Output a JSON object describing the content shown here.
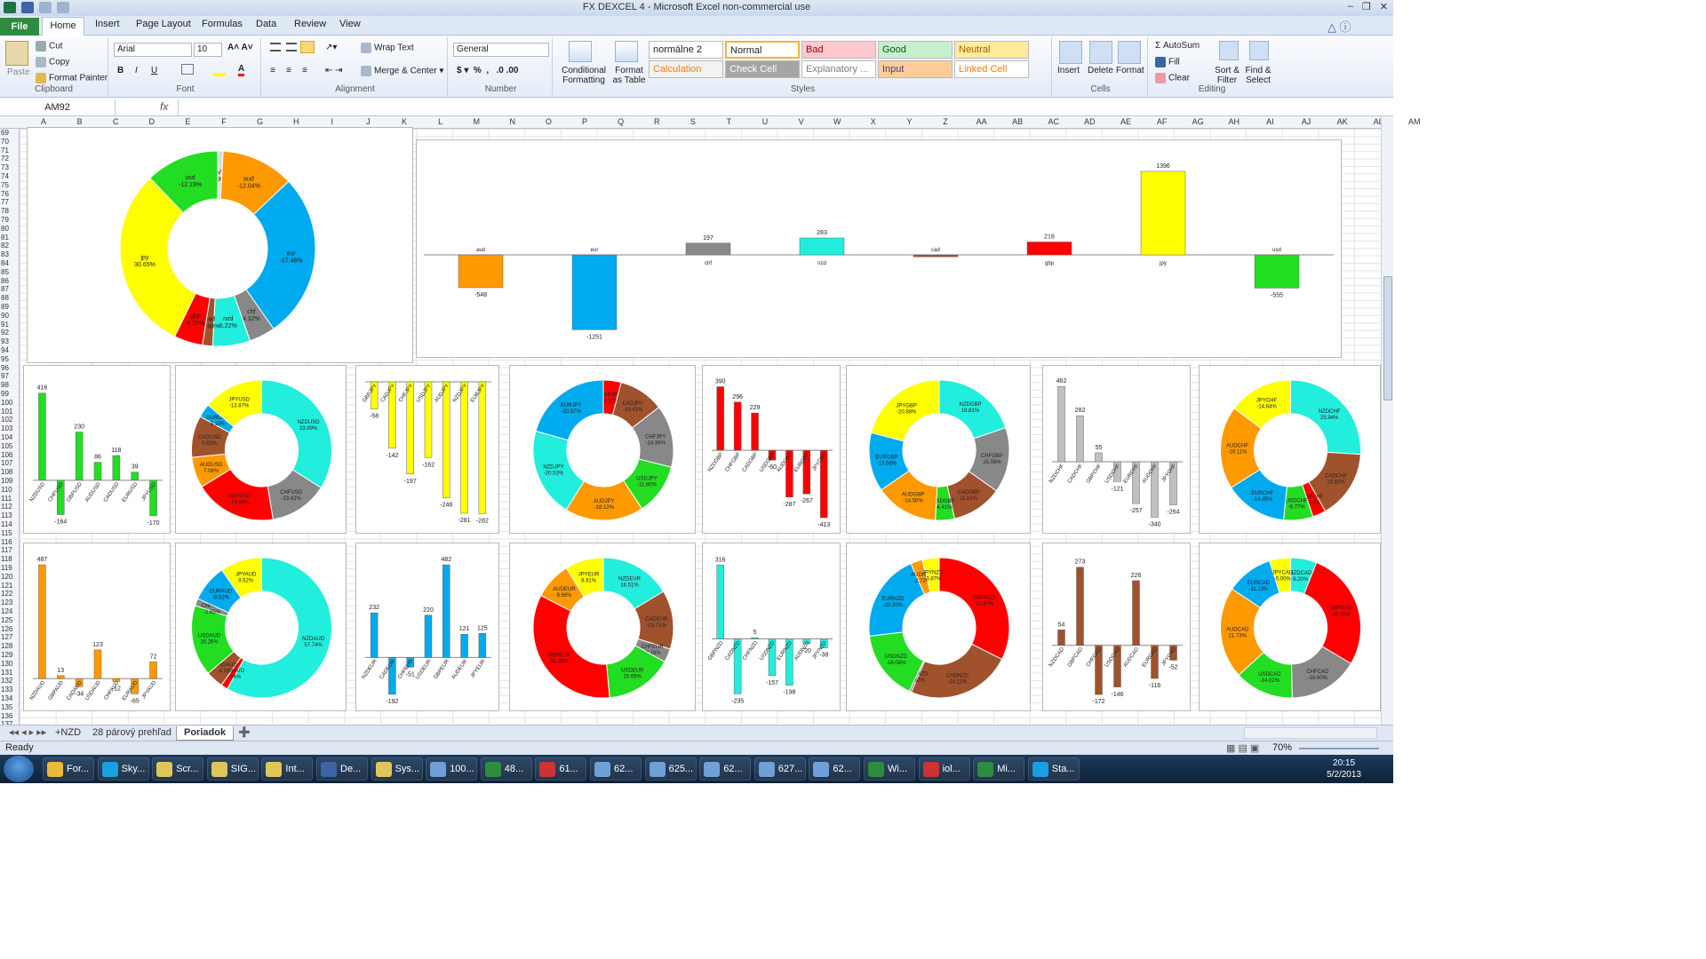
{
  "window": {
    "title": "FX DEXCEL 4  -  Microsoft Excel non-commercial use"
  },
  "tabs": [
    "File",
    "Home",
    "Insert",
    "Page Layout",
    "Formulas",
    "Data",
    "Review",
    "View"
  ],
  "ribbon": {
    "clipboard": {
      "paste": "Paste",
      "cut": "Cut",
      "copy": "Copy",
      "format_painter": "Format Painter",
      "label": "Clipboard"
    },
    "font": {
      "name": "Arial",
      "size": "10",
      "label": "Font"
    },
    "alignment": {
      "wrap": "Wrap Text",
      "merge": "Merge & Center",
      "label": "Alignment"
    },
    "number": {
      "format": "General",
      "label": "Number"
    },
    "styles": {
      "conditional": "Conditional Formatting",
      "format_table": "Format as Table",
      "label": "Styles",
      "cells": [
        {
          "text": "normálne 2",
          "bg": "#ffffff",
          "fg": "#222222"
        },
        {
          "text": "Normal",
          "bg": "#ffffff",
          "fg": "#222222"
        },
        {
          "text": "Bad",
          "bg": "#ffc7ce",
          "fg": "#9c0006"
        },
        {
          "text": "Good",
          "bg": "#c6efce",
          "fg": "#006100"
        },
        {
          "text": "Neutral",
          "bg": "#ffeb9c",
          "fg": "#9c6500"
        },
        {
          "text": "Calculation",
          "bg": "#f2f2f2",
          "fg": "#fa7d00"
        },
        {
          "text": "Check Cell",
          "bg": "#a5a5a5",
          "fg": "#ffffff"
        },
        {
          "text": "Explanatory ...",
          "bg": "#ffffff",
          "fg": "#7f7f7f"
        },
        {
          "text": "Input",
          "bg": "#ffcc99",
          "fg": "#3f3f76"
        },
        {
          "text": "Linked Cell",
          "bg": "#ffffff",
          "fg": "#fa7d00"
        }
      ]
    },
    "cells": {
      "insert": "Insert",
      "delete": "Delete",
      "format": "Format",
      "label": "Cells"
    },
    "editing": {
      "autosum": "AutoSum",
      "fill": "Fill",
      "clear": "Clear",
      "sort": "Sort & Filter",
      "find": "Find & Select",
      "label": "Editing"
    }
  },
  "formula_bar": {
    "name_box": "AM92",
    "fx": "fx",
    "value": ""
  },
  "columns": [
    "A",
    "B",
    "C",
    "D",
    "E",
    "F",
    "G",
    "H",
    "I",
    "J",
    "K",
    "L",
    "M",
    "N",
    "O",
    "P",
    "Q",
    "R",
    "S",
    "T",
    "U",
    "V",
    "W",
    "X",
    "Y",
    "Z",
    "AA",
    "AB",
    "AC",
    "AD",
    "AE",
    "AF",
    "AG",
    "AH",
    "AI",
    "AJ",
    "AK",
    "AL",
    "AM"
  ],
  "rows": [
    "69",
    "70",
    "71",
    "72",
    "73",
    "74",
    "75",
    "76",
    "77",
    "78",
    "79",
    "80",
    "81",
    "82",
    "83",
    "84",
    "85",
    "86",
    "87",
    "88",
    "89",
    "90",
    "91",
    "92",
    "93",
    "94",
    "95",
    "96",
    "97",
    "98",
    "99",
    "100",
    "101",
    "102",
    "103",
    "104",
    "105",
    "106",
    "107",
    "108",
    "109",
    "110",
    "111",
    "112",
    "113",
    "114",
    "115",
    "116",
    "117",
    "118",
    "119",
    "120",
    "121",
    "122",
    "123",
    "124",
    "125",
    "126",
    "127",
    "128",
    "129",
    "130",
    "131",
    "132",
    "133",
    "134",
    "135",
    "136",
    "137"
  ],
  "colors": {
    "aud": "#ff9900",
    "eur": "#00aaee",
    "chf": "#888888",
    "nzd": "#22eedd",
    "cad": "#a0522d",
    "gbp": "#ff0000",
    "jpy": "#ffff00",
    "usd": "#22dd22",
    "avg": "#dddddd"
  },
  "chart_data": [
    {
      "type": "pie",
      "name": "main-donut",
      "slices": [
        {
          "label": "AVG",
          "pct": "-0.90%",
          "value": 0.9,
          "color": "#dddddd"
        },
        {
          "label": "aud",
          "pct": "-12.04%",
          "value": 12.04,
          "color": "#ff9900"
        },
        {
          "label": "eur",
          "pct": "-27.46%",
          "value": 27.46,
          "color": "#00aaee"
        },
        {
          "label": "chf",
          "pct": "4.32%",
          "value": 4.32,
          "color": "#888888"
        },
        {
          "label": "nzd",
          "pct": "6.22%",
          "value": 6.22,
          "color": "#22eedd"
        },
        {
          "label": "cad",
          "pct": "-1.68%",
          "value": 1.68,
          "color": "#a0522d"
        },
        {
          "label": "gbp",
          "pct": "4.75%",
          "value": 4.75,
          "color": "#ff0000"
        },
        {
          "label": "jpy",
          "pct": "30.65%",
          "value": 30.65,
          "color": "#ffff00"
        },
        {
          "label": "usd",
          "pct": "-12.19%",
          "value": 12.19,
          "color": "#22dd22"
        }
      ]
    },
    {
      "type": "bar",
      "name": "main-bars",
      "categories": [
        "aud",
        "eur",
        "chf",
        "nzd",
        "cad",
        "gbp",
        "jpy",
        "usd"
      ],
      "values": [
        -548,
        -1251,
        197,
        283,
        -32,
        216,
        1396,
        -555
      ],
      "labels": [
        "-548",
        "-1251",
        "197",
        "283",
        "",
        "216",
        "1396",
        "-555"
      ],
      "colors": [
        "#ff9900",
        "#00aaee",
        "#888888",
        "#22eedd",
        "#a0522d",
        "#ff0000",
        "#ffff00",
        "#22dd22"
      ],
      "ylim": [
        -1350,
        1500
      ]
    },
    {
      "type": "bar",
      "name": "usd-bars",
      "categories": [
        "NZDUSD",
        "CHFUSD",
        "GBPUSD",
        "AUDUSD",
        "CADUSD",
        "EURUSD",
        "JPYUSD"
      ],
      "values": [
        416,
        -164,
        230,
        86,
        118,
        39,
        -170
      ],
      "colors": [
        "#22dd22"
      ],
      "ylim": [
        -200,
        470
      ]
    },
    {
      "type": "pie",
      "name": "usd-donut",
      "slices": [
        {
          "label": "NZDUSD",
          "pct": "33.99%",
          "value": 33.99,
          "color": "#22eedd"
        },
        {
          "label": "CHFUSD",
          "pct": "-13.42%",
          "value": 13.42,
          "color": "#888888"
        },
        {
          "label": "GBPUSD",
          "pct": "-18.88%",
          "value": 18.88,
          "color": "#ff0000"
        },
        {
          "label": "AUDUSD",
          "pct": "7.08%",
          "value": 7.08,
          "color": "#ff9900"
        },
        {
          "label": "CADUSD",
          "pct": "9.63%",
          "value": 9.63,
          "color": "#a0522d"
        },
        {
          "label": "EURUSD",
          "pct": "3.15%",
          "value": 3.15,
          "color": "#00aaee"
        },
        {
          "label": "JPYUSD",
          "pct": "-13.87%",
          "value": 13.87,
          "color": "#ffff00"
        }
      ]
    },
    {
      "type": "bar",
      "name": "jpy-bars",
      "categories": [
        "GBPJPY",
        "CADJPY",
        "CHFJPY",
        "USDJPY",
        "AUDJPY",
        "NZDJPY",
        "EURJPY"
      ],
      "values": [
        -58,
        -142,
        -197,
        -162,
        -248,
        -281,
        -282
      ],
      "colors": [
        "#ffff00"
      ],
      "ylim": [
        -300,
        0
      ]
    },
    {
      "type": "pie",
      "name": "jpy-donut",
      "slices": [
        {
          "label": "GBPJPY",
          "pct": "-4.10%",
          "value": 4.1,
          "color": "#ff0000"
        },
        {
          "label": "CADJPY",
          "pct": "-10.41%",
          "value": 10.41,
          "color": "#a0522d"
        },
        {
          "label": "CHFJPY",
          "pct": "-14.36%",
          "value": 14.36,
          "color": "#888888"
        },
        {
          "label": "USDJPY",
          "pct": "-11.80%",
          "value": 11.8,
          "color": "#22dd22"
        },
        {
          "label": "AUDJPY",
          "pct": "-18.12%",
          "value": 18.12,
          "color": "#ff9900"
        },
        {
          "label": "NZDJPY",
          "pct": "-20.53%",
          "value": 20.53,
          "color": "#22eedd"
        },
        {
          "label": "EURJPY",
          "pct": "-20.57%",
          "value": 20.57,
          "color": "#00aaee"
        }
      ]
    },
    {
      "type": "bar",
      "name": "gbp-bars",
      "categories": [
        "NZDGBP",
        "CHFGBP",
        "CADGBP",
        "USDGBP",
        "AUDGBP",
        "EURGBP",
        "JPYGBP"
      ],
      "values": [
        390,
        296,
        229,
        -60,
        -287,
        -267,
        -413
      ],
      "colors": [
        "#ff0000"
      ],
      "ylim": [
        -440,
        420
      ]
    },
    {
      "type": "pie",
      "name": "gbp-donut",
      "slices": [
        {
          "label": "NZDGBP",
          "pct": "19.81%",
          "value": 19.81,
          "color": "#22eedd"
        },
        {
          "label": "CHFGBP",
          "pct": "15.05%",
          "value": 15.05,
          "color": "#888888"
        },
        {
          "label": "CADGBP",
          "pct": "11.61%",
          "value": 11.61,
          "color": "#a0522d"
        },
        {
          "label": "USDGBP",
          "pct": "-4.41%",
          "value": 4.41,
          "color": "#22dd22"
        },
        {
          "label": "AUDGBP",
          "pct": "-14.56%",
          "value": 14.56,
          "color": "#ff9900"
        },
        {
          "label": "EURGBP",
          "pct": "-13.58%",
          "value": 13.58,
          "color": "#00aaee"
        },
        {
          "label": "JPYGBP",
          "pct": "-20.98%",
          "value": 20.98,
          "color": "#ffff00"
        }
      ]
    },
    {
      "type": "bar",
      "name": "chf-bars",
      "categories": [
        "NZDCHF",
        "CADCHF",
        "GBPCHF",
        "USDCHF",
        "EURCHF",
        "AUDCHF",
        "JPYCHF"
      ],
      "values": [
        462,
        282,
        55,
        -121,
        -257,
        -340,
        -264
      ],
      "colors": [
        "#c0c0c0"
      ],
      "ylim": [
        -370,
        490
      ]
    },
    {
      "type": "pie",
      "name": "chf-donut",
      "slices": [
        {
          "label": "NZDCHF",
          "pct": "25.94%",
          "value": 25.94,
          "color": "#22eedd"
        },
        {
          "label": "CADCHF",
          "pct": "15.82%",
          "value": 15.82,
          "color": "#a0522d"
        },
        {
          "label": "GBPCHF",
          "pct": "3.08%",
          "value": 3.08,
          "color": "#ff0000"
        },
        {
          "label": "USDCHF",
          "pct": "-6.77%",
          "value": 6.77,
          "color": "#22dd22"
        },
        {
          "label": "EURCHF",
          "pct": "-14.45%",
          "value": 14.45,
          "color": "#00aaee"
        },
        {
          "label": "AUDCHF",
          "pct": "-19.11%",
          "value": 19.11,
          "color": "#ff9900"
        },
        {
          "label": "JPYCHF",
          "pct": "-14.84%",
          "value": 14.84,
          "color": "#ffff00"
        }
      ]
    },
    {
      "type": "bar",
      "name": "aud-bars",
      "categories": [
        "NZDAUD",
        "GBPAUD",
        "CADAUD",
        "USDAUD",
        "CHFAUD",
        "EURAUD",
        "JPYAUD"
      ],
      "values": [
        487,
        13,
        -34,
        123,
        -12,
        -65,
        72
      ],
      "colors": [
        "#ff9900"
      ],
      "ylim": [
        -90,
        510
      ]
    },
    {
      "type": "pie",
      "name": "aud-donut",
      "slices": [
        {
          "label": "NZDAUD",
          "pct": "57.74%",
          "value": 57.74,
          "color": "#22eedd"
        },
        {
          "label": "GBPAUD",
          "pct": "1.54%",
          "value": 1.54,
          "color": "#ff0000"
        },
        {
          "label": "CADAUD",
          "pct": "-4.03%",
          "value": 4.03,
          "color": "#a0522d"
        },
        {
          "label": "USDAUD",
          "pct": "16.26%",
          "value": 16.26,
          "color": "#22dd22"
        },
        {
          "label": "CHFAUD",
          "pct": "-1.65%",
          "value": 1.65,
          "color": "#888888"
        },
        {
          "label": "EURAUD",
          "pct": "-8.52%",
          "value": 8.52,
          "color": "#00aaee"
        },
        {
          "label": "JPYAUD",
          "pct": "9.52%",
          "value": 9.52,
          "color": "#ffff00"
        }
      ]
    },
    {
      "type": "bar",
      "name": "eur-bars",
      "categories": [
        "NZDEUR",
        "CADEUR",
        "CHFEUR",
        "USDEUR",
        "GBPEUR",
        "AUDEUR",
        "JPYEUR"
      ],
      "values": [
        232,
        -192,
        -51,
        220,
        482,
        121,
        125
      ],
      "colors": [
        "#00aaee"
      ],
      "ylim": [
        -220,
        510
      ]
    },
    {
      "type": "pie",
      "name": "eur-donut",
      "slices": [
        {
          "label": "NZDEUR",
          "pct": "16.51%",
          "value": 16.51,
          "color": "#22eedd"
        },
        {
          "label": "CADEUR",
          "pct": "-13.71%",
          "value": 13.71,
          "color": "#a0522d"
        },
        {
          "label": "CHFEUR",
          "pct": "-3.19%",
          "value": 3.19,
          "color": "#888888"
        },
        {
          "label": "USDEUR",
          "pct": "15.66%",
          "value": 15.66,
          "color": "#22dd22"
        },
        {
          "label": "GBPEUR",
          "pct": "34.36%",
          "value": 34.36,
          "color": "#ff0000"
        },
        {
          "label": "AUDEUR",
          "pct": "8.66%",
          "value": 8.66,
          "color": "#ff9900"
        },
        {
          "label": "JPYEUR",
          "pct": "8.91%",
          "value": 8.91,
          "color": "#ffff00"
        }
      ]
    },
    {
      "type": "bar",
      "name": "nzd-bars",
      "categories": [
        "GBPNZD",
        "CADNZD",
        "CHFNZD",
        "USDNZD",
        "EURNZD",
        "AUDNZD",
        "JPYNZD"
      ],
      "values": [
        316,
        -235,
        5,
        -157,
        -198,
        -20,
        -38
      ],
      "colors": [
        "#22eedd"
      ],
      "ylim": [
        -260,
        340
      ]
    },
    {
      "type": "pie",
      "name": "nzd-donut",
      "slices": [
        {
          "label": "GBPNZD",
          "pct": "32.40%",
          "value": 32.4,
          "color": "#ff0000"
        },
        {
          "label": "CADNZD",
          "pct": "-24.11%",
          "value": 24.11,
          "color": "#a0522d"
        },
        {
          "label": "CHFNZD",
          "pct": "0.52%",
          "value": 0.52,
          "color": "#888888"
        },
        {
          "label": "USDNZD",
          "pct": "-16.08%",
          "value": 16.08,
          "color": "#22dd22"
        },
        {
          "label": "EURNZD",
          "pct": "-20.30%",
          "value": 20.3,
          "color": "#00aaee"
        },
        {
          "label": "AUDNZD",
          "pct": "-2.72%",
          "value": 2.72,
          "color": "#ff9900"
        },
        {
          "label": "JPYNZD",
          "pct": "-3.87%",
          "value": 3.87,
          "color": "#ffff00"
        }
      ]
    },
    {
      "type": "bar",
      "name": "cad-bars",
      "categories": [
        "NZDCAD",
        "GBPCAD",
        "CHFCAD",
        "USDCAD",
        "AUDCAD",
        "EURCAD",
        "JPYCAD"
      ],
      "values": [
        54,
        273,
        -172,
        -146,
        226,
        -116,
        -52
      ],
      "colors": [
        "#a0522d"
      ],
      "ylim": [
        -190,
        300
      ]
    },
    {
      "type": "pie",
      "name": "cad-donut",
      "slices": [
        {
          "label": "NZDCAD",
          "pct": "6.20%",
          "value": 6.2,
          "color": "#22eedd"
        },
        {
          "label": "GBPCAD",
          "pct": "28.31%",
          "value": 28.31,
          "color": "#ff0000"
        },
        {
          "label": "CHFCAD",
          "pct": "-16.60%",
          "value": 16.6,
          "color": "#888888"
        },
        {
          "label": "USDCAD",
          "pct": "-14.02%",
          "value": 14.02,
          "color": "#22dd22"
        },
        {
          "label": "AUDCAD",
          "pct": "21.73%",
          "value": 21.73,
          "color": "#ff9900"
        },
        {
          "label": "EURCAD",
          "pct": "-11.13%",
          "value": 11.13,
          "color": "#00aaee"
        },
        {
          "label": "JPYCAD",
          "pct": "-5.00%",
          "value": 5.0,
          "color": "#ffff00"
        }
      ]
    }
  ],
  "sheets": [
    "+NZD",
    "28 párový prehľad",
    "Poriadok"
  ],
  "status": {
    "ready": "Ready",
    "zoom": "70%"
  },
  "taskbar": {
    "items": [
      "For...",
      "Sky...",
      "Scr...",
      "SIG...",
      "Int...",
      "De...",
      "Sys...",
      "100...",
      "48...",
      "61...",
      "62...",
      "625...",
      "62...",
      "627...",
      "62...",
      "Wi...",
      "iol...",
      "Mi...",
      "Sta..."
    ],
    "time": "20:15",
    "date": "5/2/2013"
  }
}
